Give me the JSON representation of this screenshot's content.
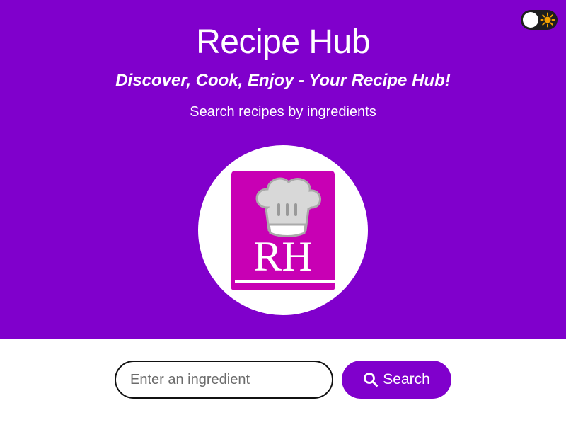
{
  "header": {
    "title": "Recipe Hub",
    "tagline": "Discover, Cook, Enjoy - Your Recipe Hub!",
    "subtitle": "Search recipes by ingredients"
  },
  "logo": {
    "text": "RH",
    "icon": "chef-hat-book-logo"
  },
  "theme_toggle": {
    "icon": "sun-icon",
    "state": "light"
  },
  "search": {
    "placeholder": "Enter an ingredient",
    "value": "",
    "button_label": "Search",
    "button_icon": "search-icon"
  },
  "colors": {
    "primary": "#8000cc",
    "logo_book": "#c800b4",
    "background": "#ffffff",
    "sun": "#f5a000"
  }
}
